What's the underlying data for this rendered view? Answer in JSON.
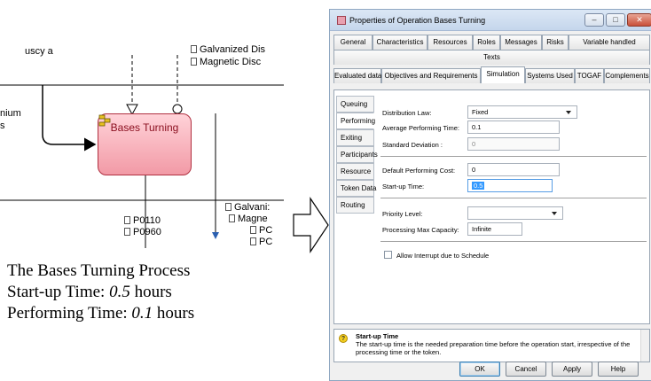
{
  "diagram": {
    "top_left_fragment": "uscy a",
    "top_right_items": [
      "Galvanized Dis",
      "Magnetic Disc"
    ],
    "left_fragments": [
      "nium",
      "s"
    ],
    "task_label": "Bases Turning",
    "bottom_left_items": [
      "P0110",
      "P0960"
    ],
    "bottom_right_items": [
      "Galvani:",
      "Magne",
      "PC",
      "PC"
    ],
    "colors": {
      "task_fill": "#f7b5be",
      "task_border": "#b03040",
      "task_text": "#8b1020"
    }
  },
  "caption": {
    "line1": "The Bases Turning Process",
    "line2_prefix": "Start-up Time: ",
    "line2_value": "0.5",
    "line2_suffix": " hours",
    "line3_prefix": "Performing Time: ",
    "line3_value": "0.1",
    "line3_suffix": " hours"
  },
  "dialog": {
    "title": "Properties of Operation Bases Turning",
    "window_buttons": {
      "minimize": "–",
      "maximize": "□",
      "close": "✕"
    },
    "tabs_row1": [
      "General",
      "Characteristics",
      "Resources",
      "Roles",
      "Messages",
      "Risks",
      "Variable handled"
    ],
    "tabs_row2": [
      "Texts"
    ],
    "tabs_row3": [
      "Evaluated data",
      "Objectives and Requirements",
      "Simulation",
      "Systems Used",
      "TOGAF",
      "Complements"
    ],
    "active_tab": "Simulation",
    "side_tabs": [
      "Queuing",
      "Performing",
      "Exiting",
      "Participants",
      "Resource",
      "Token Data",
      "Routing"
    ],
    "active_side_tab": "Performing",
    "fields": {
      "distribution_law_label": "Distribution Law:",
      "distribution_law_value": "Fixed",
      "avg_performing_time_label": "Average Performing Time:",
      "avg_performing_time_value": "0.1",
      "std_deviation_label": "Standard Deviation :",
      "std_deviation_value": "0",
      "default_cost_label": "Default Performing Cost:",
      "default_cost_value": "0",
      "startup_time_label": "Start-up Time:",
      "startup_time_value": "0.5",
      "priority_level_label": "Priority Level:",
      "priority_level_value": "",
      "max_capacity_label": "Processing Max Capacity:",
      "max_capacity_value": "Infinite",
      "allow_interrupt_label": "Allow Interrupt due to Schedule"
    },
    "help": {
      "title": "Start-up Time",
      "body": "The start-up time is the needed preparation time before the operation start, irrespective of the processing time or the token."
    },
    "buttons": {
      "ok": "OK",
      "cancel": "Cancel",
      "apply": "Apply",
      "help": "Help"
    },
    "colors": {
      "selection": "#3399ff",
      "title_gradient_top": "#dbe7f5"
    }
  }
}
